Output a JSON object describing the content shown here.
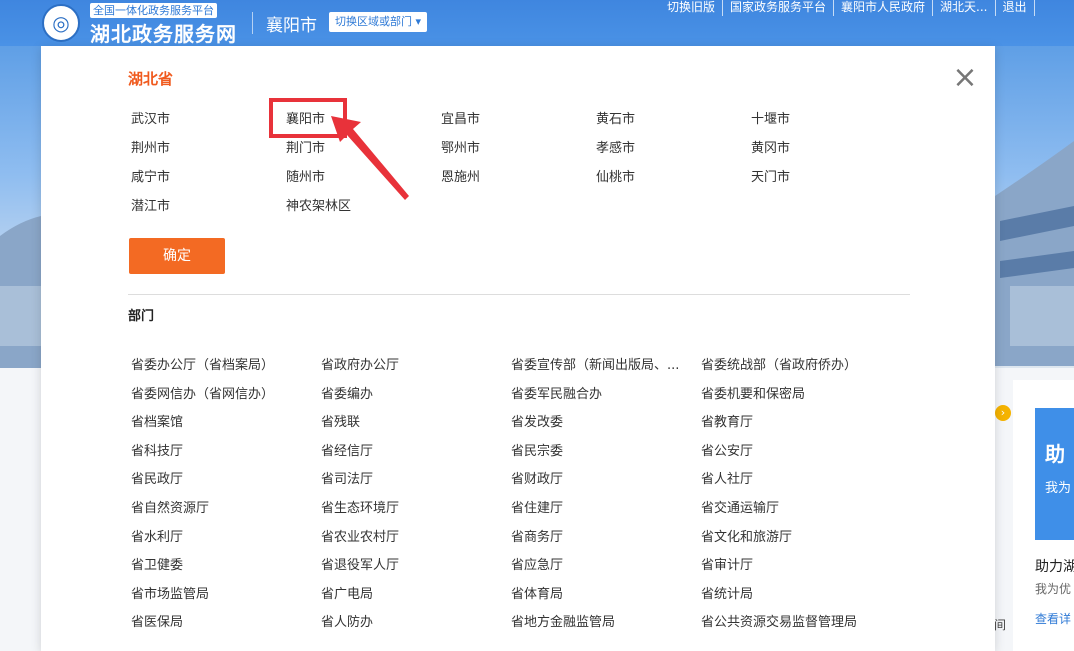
{
  "header": {
    "platform_tag": "全国一体化政务服务平台",
    "site_title": "湖北政务服务网",
    "logo_glyph": "◎",
    "current_city": "襄阳市",
    "switch_button": "切换区域或部门 ▾",
    "top_links": [
      "切换旧版",
      "国家政务服务平台",
      "襄阳市人民政府",
      "湖北天...",
      "退出"
    ]
  },
  "modal": {
    "close_glyph": "×",
    "province_title": "湖北省",
    "cities": [
      [
        "武汉市",
        "襄阳市",
        "宜昌市",
        "黄石市",
        "十堰市"
      ],
      [
        "荆州市",
        "荆门市",
        "鄂州市",
        "孝感市",
        "黄冈市"
      ],
      [
        "咸宁市",
        "随州市",
        "恩施州",
        "仙桃市",
        "天门市"
      ],
      [
        "潜江市",
        "神农架林区"
      ]
    ],
    "highlighted_city": "襄阳市",
    "confirm_button": "确定",
    "dept_section_title": "部门",
    "departments": [
      [
        "省委办公厅（省档案局）",
        "省政府办公厅",
        "省委宣传部（新闻出版局、...",
        "省委统战部（省政府侨办）"
      ],
      [
        "省委网信办（省网信办）",
        "省委编办",
        "省委军民融合办",
        "省委机要和保密局"
      ],
      [
        "省档案馆",
        "省残联",
        "省发改委",
        "省教育厅"
      ],
      [
        "省科技厅",
        "省经信厅",
        "省民宗委",
        "省公安厅"
      ],
      [
        "省民政厅",
        "省司法厅",
        "省财政厅",
        "省人社厅"
      ],
      [
        "省自然资源厅",
        "省生态环境厅",
        "省住建厅",
        "省交通运输厅"
      ],
      [
        "省水利厅",
        "省农业农村厅",
        "省商务厅",
        "省文化和旅游厅"
      ],
      [
        "省卫健委",
        "省退役军人厅",
        "省应急厅",
        "省审计厅"
      ],
      [
        "省市场监管局",
        "省广电局",
        "省体育局",
        "省统计局"
      ],
      [
        "省医保局",
        "省人防办",
        "省地方金融监管局",
        "省公共资源交易监督管理局"
      ]
    ]
  },
  "background": {
    "side_banner_title": "助",
    "side_banner_sub": "我为",
    "side_card_title": "助力湖",
    "side_card_desc": "我为优",
    "side_card_link": "查看详",
    "peek_text": "间",
    "carousel_dot": "›"
  },
  "colors": {
    "header_blue": "#3f86df",
    "accent_orange": "#f36a23",
    "title_orange": "#f05a1e",
    "highlight_red": "#e8323a"
  }
}
